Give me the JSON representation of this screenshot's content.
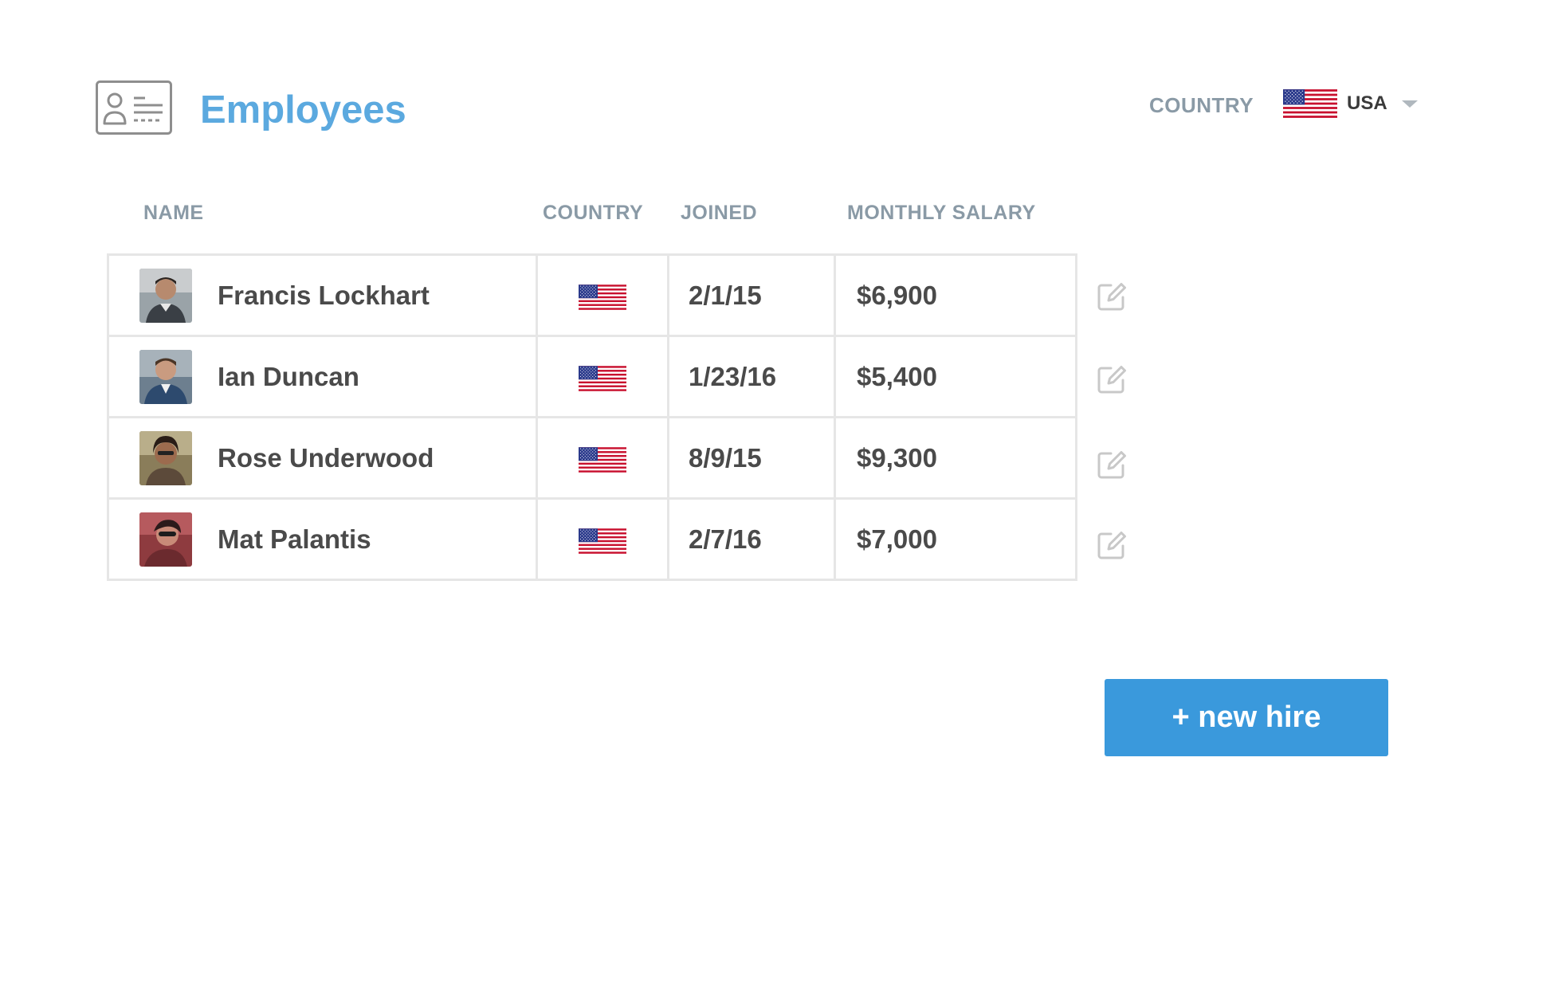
{
  "header": {
    "title": "Employees",
    "icon": "id-card-icon",
    "country_filter": {
      "label": "COUNTRY",
      "selected": "USA",
      "flag_icon": "us-flag-icon"
    }
  },
  "table": {
    "columns": [
      "NAME",
      "COUNTRY",
      "JOINED",
      "MONTHLY SALARY"
    ],
    "rows": [
      {
        "name": "Francis Lockhart",
        "country_flag": "us-flag-icon",
        "joined": "2/1/15",
        "salary": "$6,900"
      },
      {
        "name": "Ian Duncan",
        "country_flag": "us-flag-icon",
        "joined": "1/23/16",
        "salary": "$5,400"
      },
      {
        "name": "Rose Underwood",
        "country_flag": "us-flag-icon",
        "joined": "8/9/15",
        "salary": "$9,300"
      },
      {
        "name": "Mat Palantis",
        "country_flag": "us-flag-icon",
        "joined": "2/7/16",
        "salary": "$7,000"
      }
    ],
    "row_action_icon": "edit-icon"
  },
  "actions": {
    "new_hire_label": "+ new hire"
  },
  "colors": {
    "title": "#5ba9df",
    "header_text": "#8a9aa6",
    "body_text": "#4a4a4a",
    "button": "#3a99dc",
    "border": "#e6e6e6",
    "edit_icon": "#c8c8c8"
  }
}
